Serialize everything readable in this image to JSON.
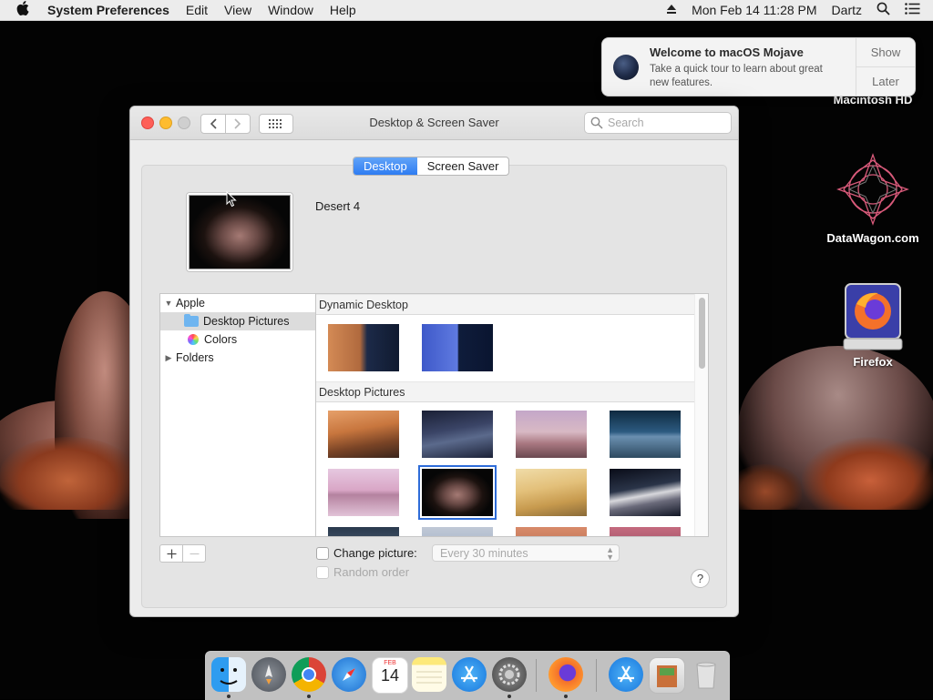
{
  "menubar": {
    "app_name": "System Preferences",
    "menus": [
      "Edit",
      "View",
      "Window",
      "Help"
    ],
    "datetime": "Mon Feb 14  11:28 PM",
    "user": "Dartz"
  },
  "desktop_icons": [
    {
      "label": "Macintosh HD",
      "icon": "hard-drive-icon"
    },
    {
      "label": "DataWagon.com",
      "icon": "mandala-icon"
    },
    {
      "label": "Firefox",
      "icon": "firefox-drive-icon"
    }
  ],
  "notification": {
    "title": "Welcome to macOS Mojave",
    "message": "Take a quick tour to learn about great new features.",
    "show_label": "Show",
    "later_label": "Later"
  },
  "window": {
    "title": "Desktop & Screen Saver",
    "search_placeholder": "Search",
    "tabs": [
      {
        "label": "Desktop",
        "active": true
      },
      {
        "label": "Screen Saver",
        "active": false
      }
    ],
    "selected_picture_name": "Desert 4",
    "sources": [
      {
        "label": "Apple",
        "expanded": true
      },
      {
        "label": "Desktop Pictures",
        "selected": true
      },
      {
        "label": "Colors"
      },
      {
        "label": "Folders",
        "expanded": false
      }
    ],
    "gallery": {
      "sections": [
        {
          "title": "Dynamic Desktop",
          "count": 2
        },
        {
          "title": "Desktop Pictures",
          "count": 12
        }
      ],
      "selected_index": 5
    },
    "change_picture_label": "Change picture:",
    "change_picture_checked": false,
    "interval_value": "Every 30 minutes",
    "random_order_label": "Random order",
    "random_order_checked": false,
    "help_label": "?"
  },
  "dock": {
    "apps": [
      "Finder",
      "Launchpad",
      "Google Chrome",
      "Safari",
      "Calendar",
      "Notes",
      "App Store",
      "System Preferences",
      "Firefox",
      "App Store Downloads",
      "Documents",
      "Trash"
    ],
    "calendar_month": "FEB",
    "calendar_day": "14"
  },
  "colors": {
    "accent": "#2e7cf2",
    "close": "#fe5f57",
    "minimize": "#febc2e"
  }
}
